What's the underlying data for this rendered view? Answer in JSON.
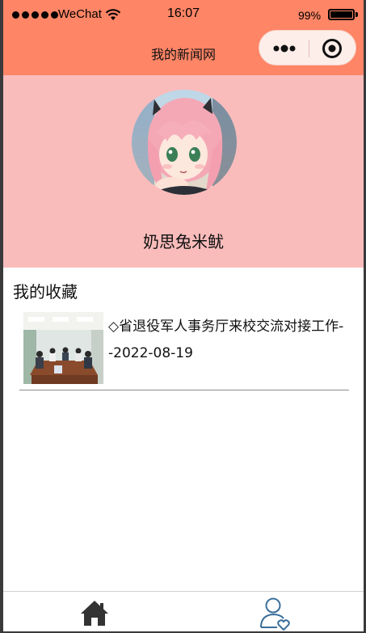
{
  "status_bar": {
    "carrier": "WeChat",
    "time": "16:07",
    "battery": "99%",
    "battery_level": 0.99,
    "signal_dots": 5
  },
  "nav": {
    "title": "我的新闻网",
    "icons": [
      "more-icon",
      "target-icon"
    ]
  },
  "profile": {
    "username": "奶思兔米鱿",
    "avatar_icon": "anime-avatar-image",
    "background_color": "#f9bcbb"
  },
  "favorites": {
    "heading": "我的收藏",
    "items": [
      {
        "title": "◇省退役军人事务厅来校交流对接工作--2022-08-19",
        "thumbnail": "meeting-room-photo"
      }
    ]
  },
  "tabbar": {
    "items": [
      {
        "icon": "home-icon"
      },
      {
        "icon": "user-heart-icon"
      }
    ]
  },
  "colors": {
    "header": "#fe8566",
    "profile_bg": "#f9bcbb",
    "tab_active": "#333333",
    "tab_inactive": "#3b6f9b"
  }
}
